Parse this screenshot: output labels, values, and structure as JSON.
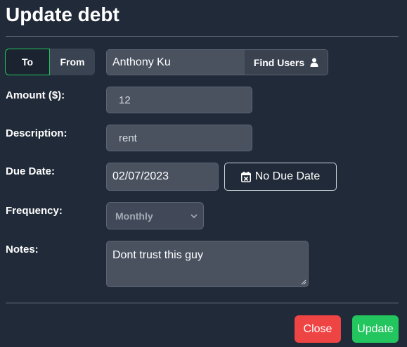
{
  "header": {
    "title": "Update debt"
  },
  "direction": {
    "to_label": "To",
    "from_label": "From",
    "selected": "To"
  },
  "user": {
    "value": "Anthony Ku",
    "find_label": "Find Users",
    "icon": "user-icon"
  },
  "labels": {
    "amount": "Amount ($):",
    "description": "Description:",
    "due_date": "Due Date:",
    "frequency": "Frequency:",
    "notes": "Notes:"
  },
  "fields": {
    "amount": "12",
    "description": "rent",
    "due_date": "02/07/2023",
    "no_due_date_label": "No Due Date",
    "frequency": "Monthly",
    "notes": "Dont trust this guy"
  },
  "footer": {
    "close_label": "Close",
    "update_label": "Update"
  },
  "colors": {
    "background": "#212a38",
    "accent_green": "#22c55e",
    "danger_red": "#ef4444"
  }
}
